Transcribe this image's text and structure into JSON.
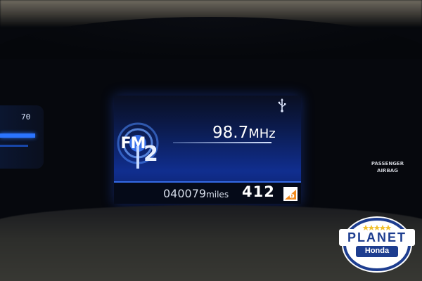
{
  "display": {
    "band": "FM",
    "preset": "2",
    "frequency_value": "98.7",
    "frequency_unit": "MHz",
    "odometer_value": "040079",
    "odometer_unit": "miles",
    "trip": "412",
    "icons": [
      "usb-icon",
      "radio-signal-icon",
      "maintenance-warning-icon"
    ]
  },
  "left_gauge": {
    "reading": "70"
  },
  "passenger_airbag": {
    "line1": "PASSENGER",
    "line2": "AIRBAG"
  },
  "logo": {
    "word": "PLANET",
    "brand": "Honda"
  },
  "colors": {
    "screen_blue": "#102e8f",
    "accent_blue": "#3f7aff",
    "warning_orange": "#f28a1d",
    "logo_blue": "#1d3d8f",
    "star_gold": "#f2c230"
  }
}
